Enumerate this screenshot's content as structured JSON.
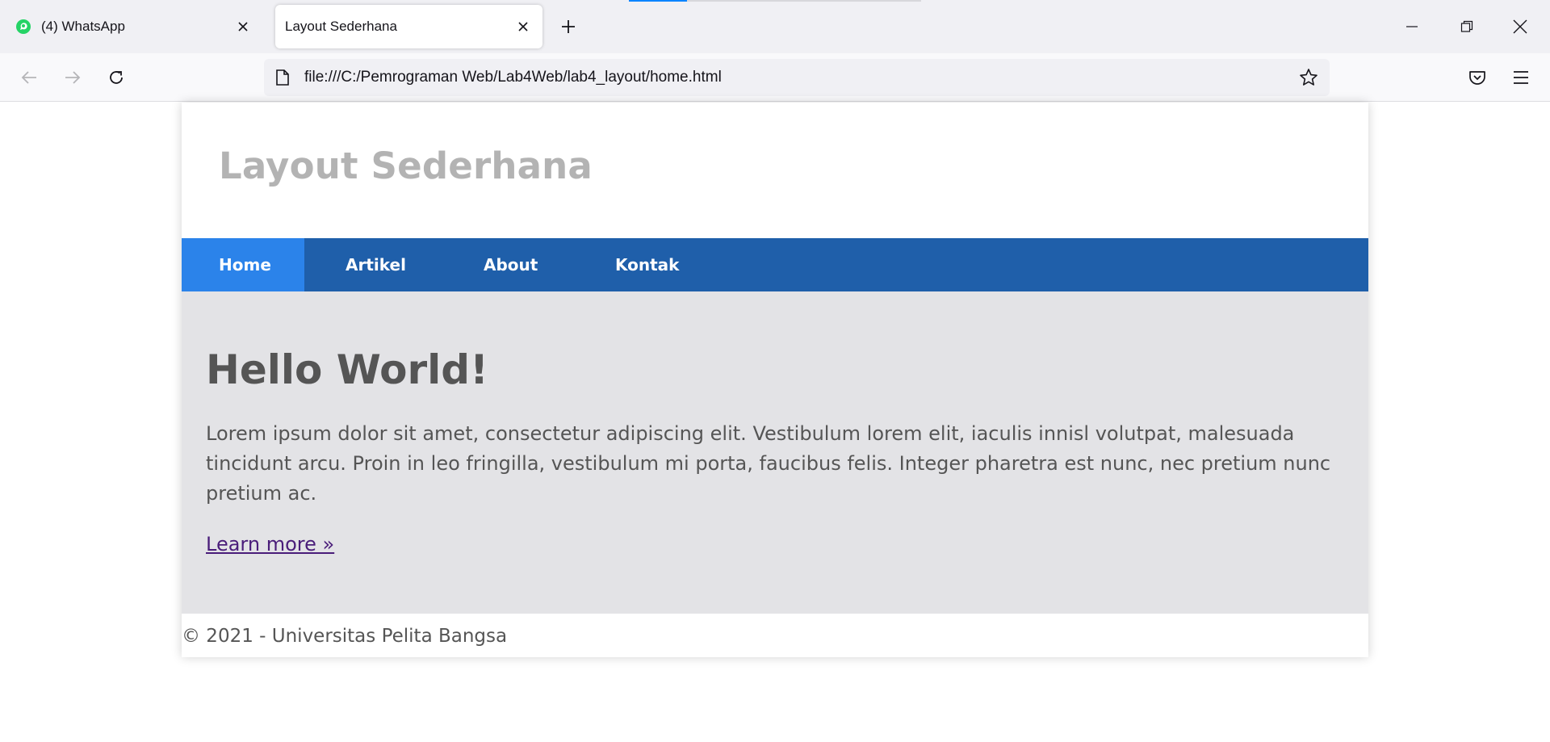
{
  "browser": {
    "tabs": [
      {
        "title": "(4) WhatsApp",
        "favicon": "whatsapp-icon",
        "active": false
      },
      {
        "title": "Layout Sederhana",
        "active": true
      }
    ],
    "address_bar": {
      "url": "file:///C:/Pemrograman Web/Lab4Web/lab4_layout/home.html"
    },
    "icons": [
      "back-arrow-icon",
      "forward-arrow-icon",
      "reload-icon",
      "page-icon",
      "star-icon",
      "pocket-icon",
      "menu-icon",
      "minimize-icon",
      "restore-icon",
      "close-icon",
      "plus-icon"
    ]
  },
  "page": {
    "site_title": "Layout Sederhana",
    "nav": [
      {
        "label": "Home",
        "active": true
      },
      {
        "label": "Artikel",
        "active": false
      },
      {
        "label": "About",
        "active": false
      },
      {
        "label": "Kontak",
        "active": false
      }
    ],
    "hero": {
      "heading": "Hello World!",
      "body": "Lorem ipsum dolor sit amet, consectetur adipiscing elit. Vestibulum lorem elit, iaculis innisl volutpat, malesuada tincidunt arcu. Proin in leo fringilla, vestibulum mi porta, faucibus felis. Integer pharetra est nunc, nec pretium nunc pretium ac.",
      "link": "Learn more »"
    },
    "footer": "© 2021 - Universitas Pelita Bangsa"
  },
  "colors": {
    "nav_bg": "#1f5faa",
    "nav_active": "#2b83ea",
    "hero_bg": "#e3e3e6",
    "title_gray": "#b3b3b3",
    "text_gray": "#555555",
    "link_visited": "#4a1d7a"
  }
}
